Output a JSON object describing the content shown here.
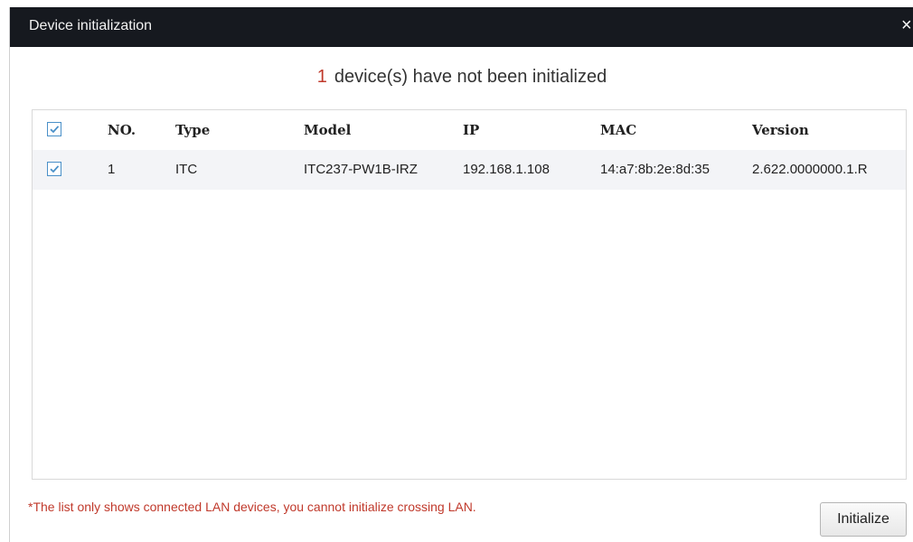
{
  "dialog": {
    "title": "Device initialization",
    "close_glyph": "×",
    "close_icon": "close-icon"
  },
  "status": {
    "count": "1",
    "message": "device(s) have not been initialized"
  },
  "table": {
    "columns": [
      "NO.",
      "Type",
      "Model",
      "IP",
      "MAC",
      "Version"
    ],
    "select_all_checked": true,
    "rows": [
      {
        "checked": true,
        "no": "1",
        "type": "ITC",
        "model": "ITC237-PW1B-IRZ",
        "ip": "192.168.1.108",
        "mac": "14:a7:8b:2e:8d:35",
        "version": "2.622.0000000.1.R"
      }
    ]
  },
  "note": "*The list only shows connected LAN devices, you cannot initialize crossing LAN.",
  "buttons": {
    "initialize": "Initialize"
  },
  "colors": {
    "titlebar": "#16191f",
    "accent_red": "#c0392b",
    "checkbox": "#4a90c8",
    "row_highlight": "#f3f4f7"
  }
}
